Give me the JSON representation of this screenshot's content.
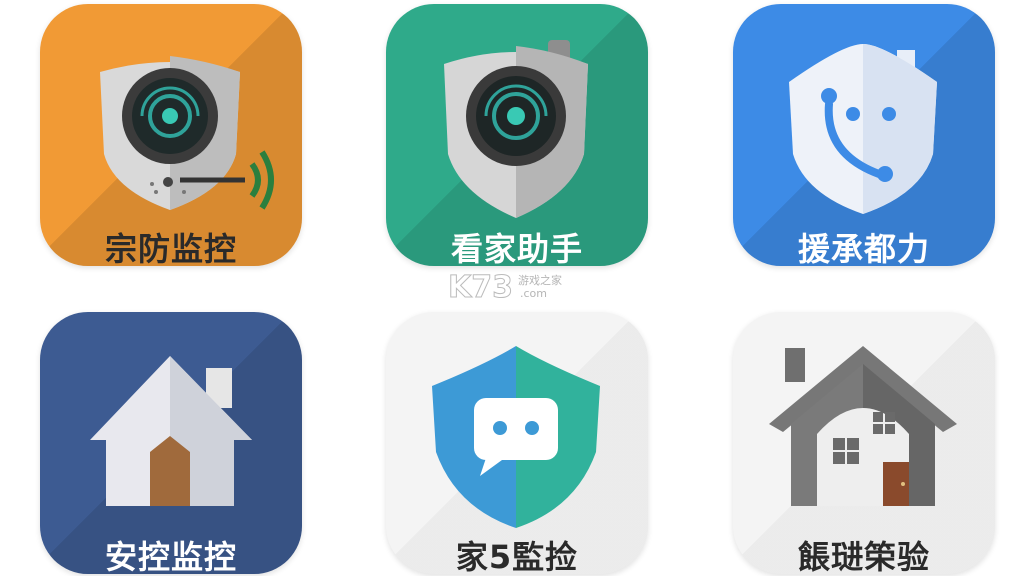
{
  "apps": [
    {
      "label": "宗防监控",
      "icon": "security-camera-shield-icon",
      "bg": "#f19a35"
    },
    {
      "label": "看家助手",
      "icon": "camera-shield-icon",
      "bg": "#2faa8a"
    },
    {
      "label": "援承都力",
      "icon": "phone-shield-icon",
      "bg": "#3d8be6"
    },
    {
      "label": "安控监控",
      "icon": "house-icon",
      "bg": "#3d5b92"
    },
    {
      "label": "家5監捡",
      "icon": "chat-shield-icon",
      "bg": "#f4f4f4"
    },
    {
      "label": "餦琎筞验",
      "icon": "house-window-icon",
      "bg": "#f4f4f4"
    }
  ],
  "watermark": {
    "brand": "K73",
    "sub": "游戏之家",
    "domain": ".com"
  }
}
